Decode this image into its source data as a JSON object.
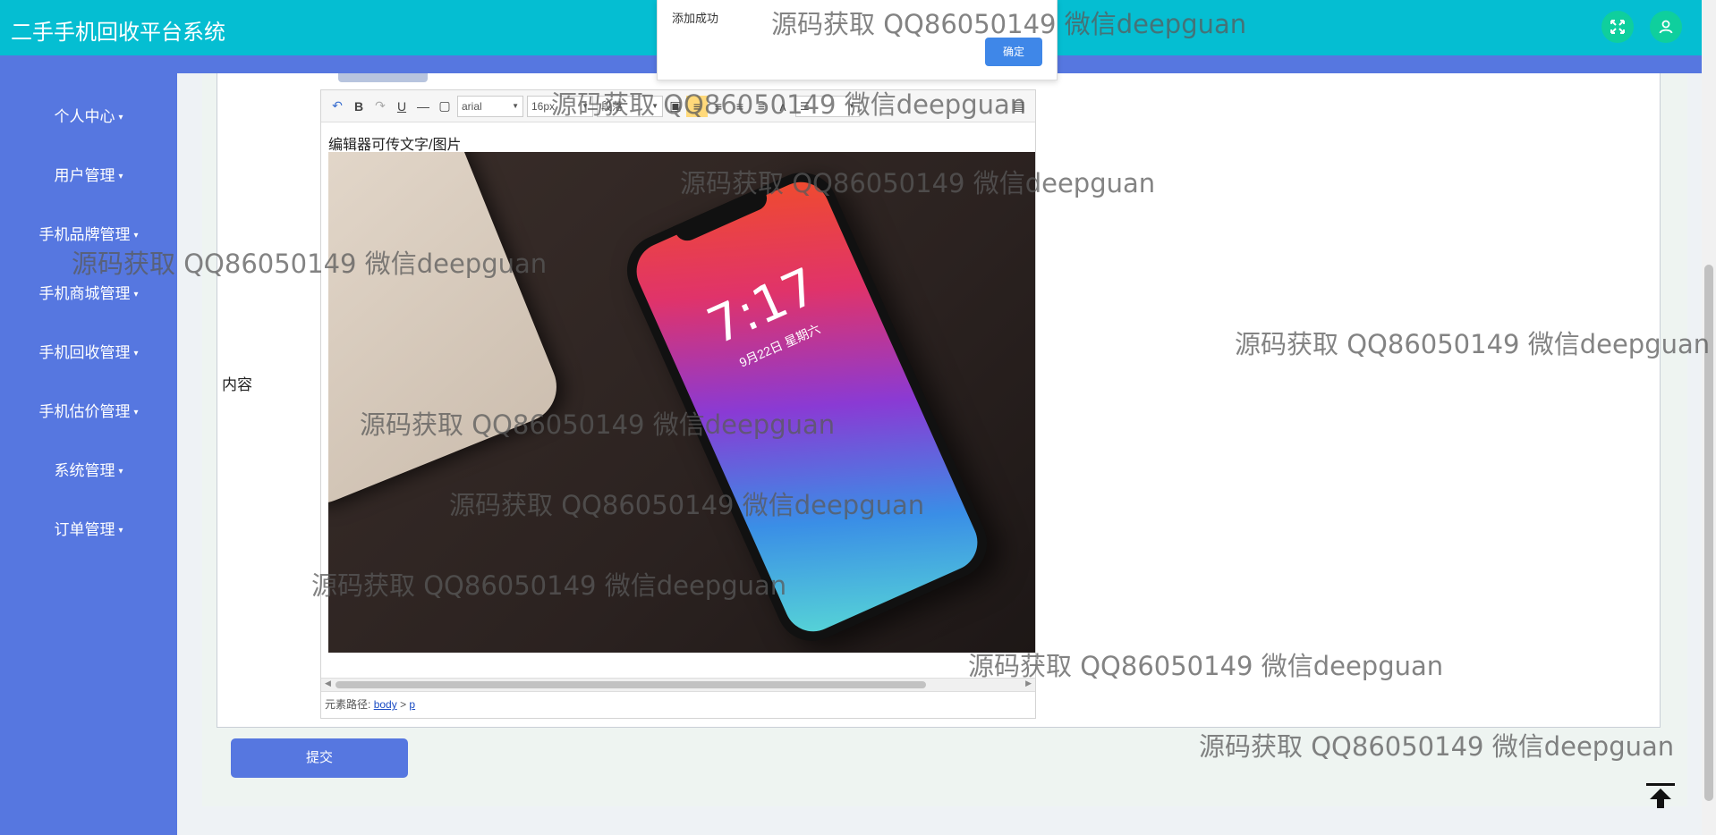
{
  "header": {
    "title": "二手手机回收平台系统",
    "fullscreen_icon": "expand-icon",
    "user_icon": "user-icon",
    "colors": {
      "header_bg": "#05bed2",
      "accent": "#5677e0",
      "header_button": "#0fcf9d"
    }
  },
  "sidebar": {
    "items": [
      {
        "label": "个人中心"
      },
      {
        "label": "用户管理"
      },
      {
        "label": "手机品牌管理"
      },
      {
        "label": "手机商城管理"
      },
      {
        "label": "手机回收管理"
      },
      {
        "label": "手机估价管理"
      },
      {
        "label": "系统管理"
      },
      {
        "label": "订单管理"
      }
    ]
  },
  "form": {
    "content_label": "内容",
    "submit_label": "提交"
  },
  "editor": {
    "font_family": "arial",
    "font_size": "16px",
    "heading": "段落",
    "body_text": "编辑器可传文字/图片",
    "path_label": "元素路径:",
    "path_body": "body",
    "path_sep": ">",
    "path_p": "p",
    "image": {
      "clock": "7:17",
      "date": "9月22日 星期六"
    }
  },
  "toast": {
    "message": "添加成功",
    "ok_label": "确定"
  },
  "watermark": "源码获取 QQ86050149 微信deepguan"
}
